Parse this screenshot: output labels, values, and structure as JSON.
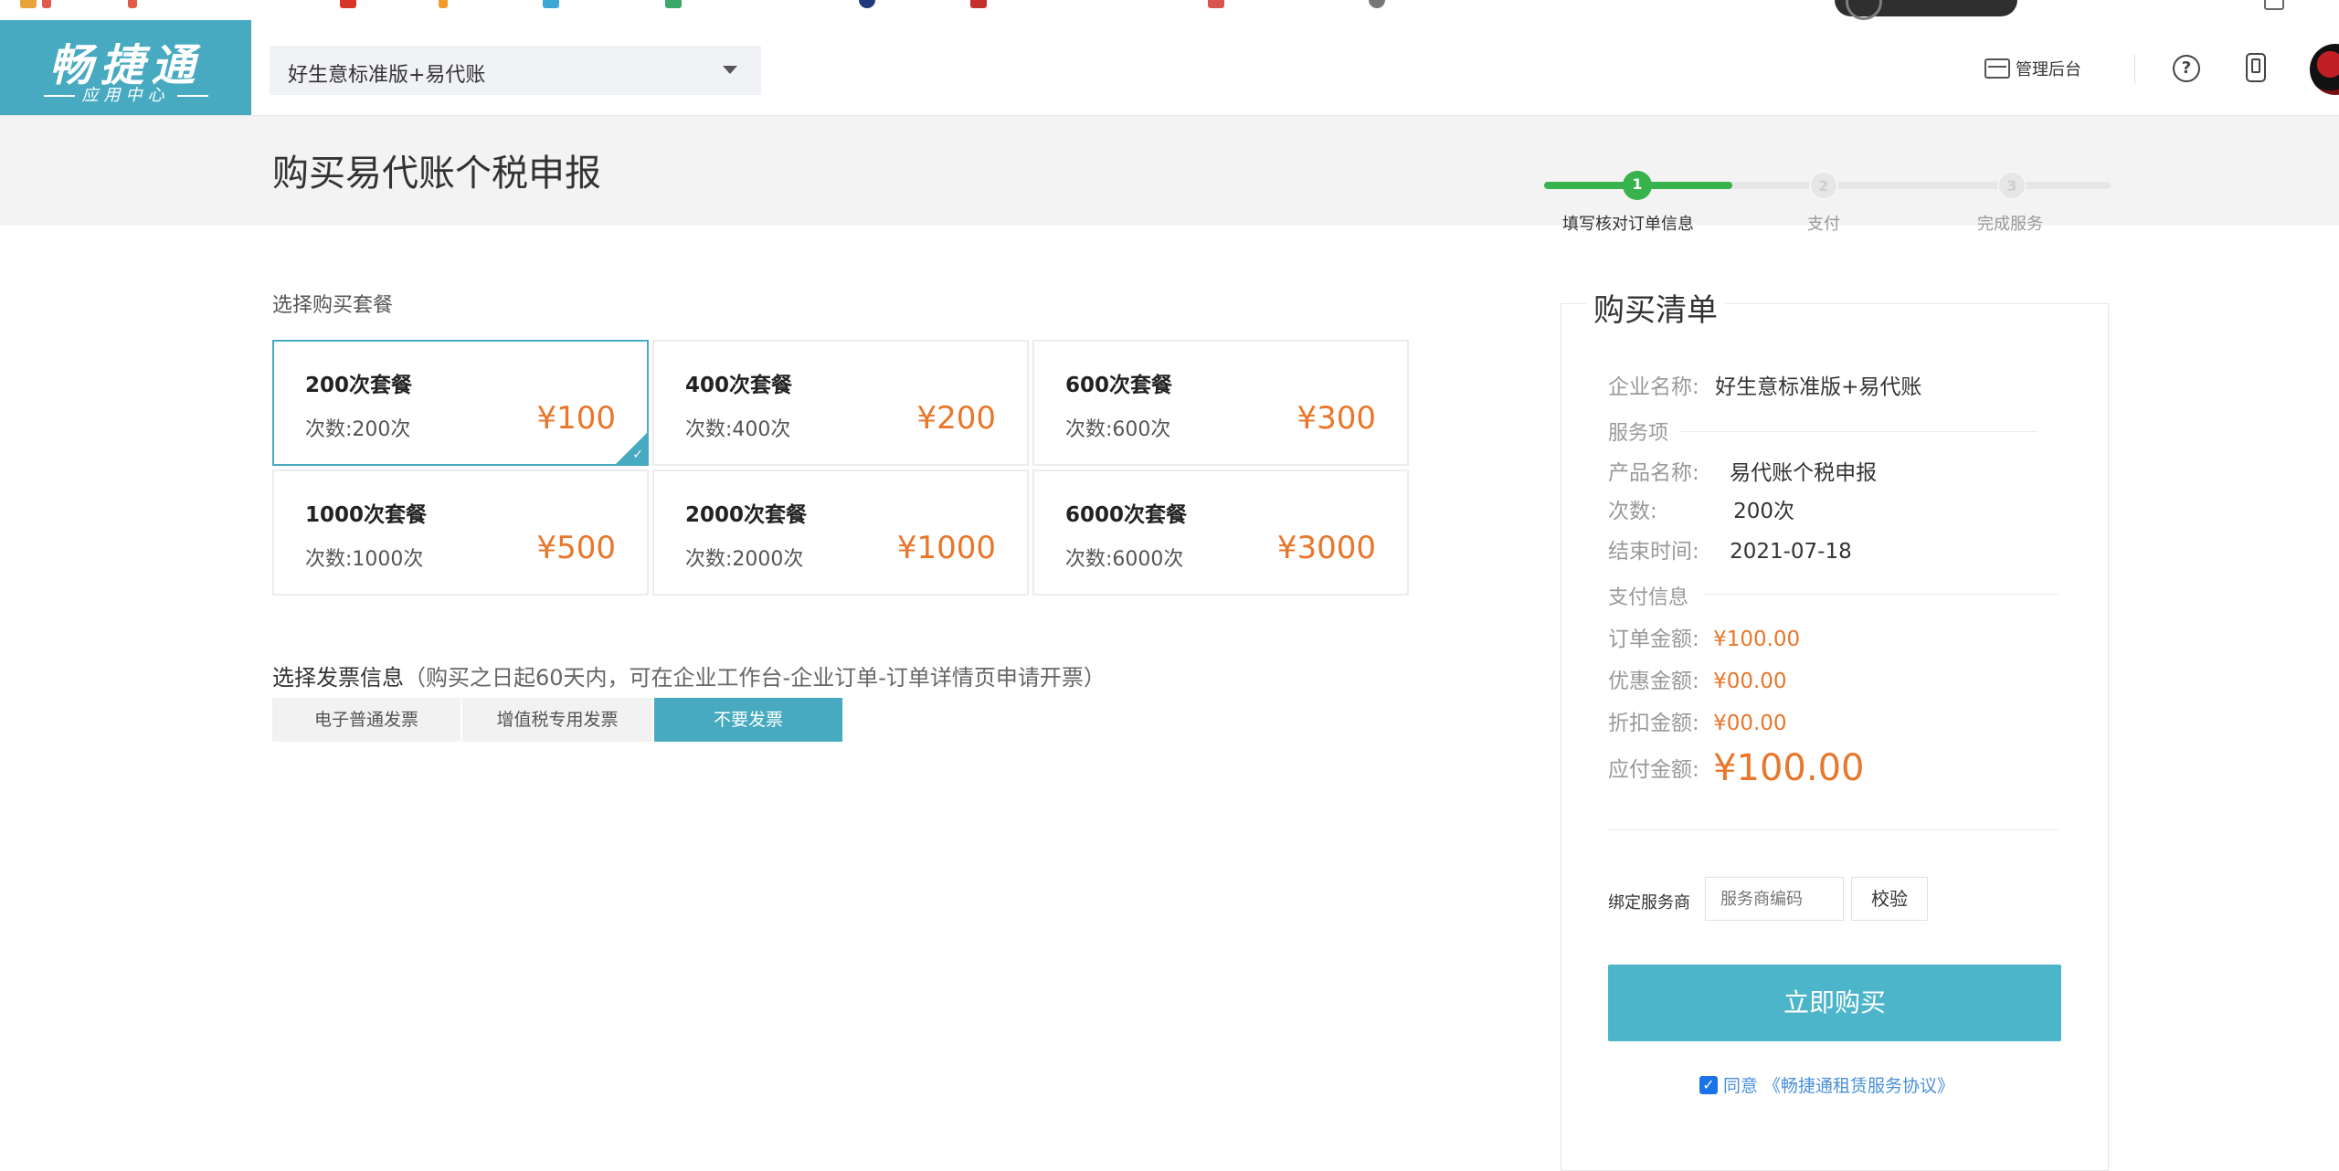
{
  "company": {
    "selected": "好生意标准版+易代账"
  },
  "header": {
    "admin_label": "管理后台"
  },
  "page": {
    "title": "购买易代账个税申报"
  },
  "steps": [
    {
      "num": "1",
      "label": "填写核对订单信息",
      "state": "active"
    },
    {
      "num": "2",
      "label": "支付",
      "state": "inactive"
    },
    {
      "num": "3",
      "label": "完成服务",
      "state": "inactive"
    }
  ],
  "packages": {
    "section_label": "选择购买套餐",
    "items": [
      {
        "name": "200次套餐",
        "count": "次数:200次",
        "price": "¥100",
        "selected": true
      },
      {
        "name": "400次套餐",
        "count": "次数:400次",
        "price": "¥200",
        "selected": false
      },
      {
        "name": "600次套餐",
        "count": "次数:600次",
        "price": "¥300",
        "selected": false
      },
      {
        "name": "1000次套餐",
        "count": "次数:1000次",
        "price": "¥500",
        "selected": false
      },
      {
        "name": "2000次套餐",
        "count": "次数:2000次",
        "price": "¥1000",
        "selected": false
      },
      {
        "name": "6000次套餐",
        "count": "次数:6000次",
        "price": "¥3000",
        "selected": false
      }
    ]
  },
  "invoice": {
    "title": "选择发票信息",
    "hint": "（购买之日起60天内，可在企业工作台-企业订单-订单详情页申请开票）",
    "options": [
      "电子普通发票",
      "增值税专用发票",
      "不要发票"
    ],
    "selected": "不要发票"
  },
  "cart": {
    "title": "购买清单",
    "company_label": "企业名称:",
    "company_value": "好生意标准版+易代账",
    "service_heading": "服务项",
    "product_label": "产品名称:",
    "product_value": "易代账个税申报",
    "count_label": "次数:",
    "count_value": "200次",
    "end_label": "结束时间:",
    "end_value": "2021-07-18",
    "pay_heading": "支付信息",
    "order_label": "订单金额:",
    "order_value": "¥100.00",
    "discount_label": "优惠金额:",
    "discount_value": "¥00.00",
    "rebate_label": "折扣金额:",
    "rebate_value": "¥00.00",
    "due_label": "应付金额:",
    "due_value": "¥100.00",
    "bind_label": "绑定服务商",
    "bind_placeholder": "服务商编码",
    "verify_label": "校验",
    "buy_label": "立即购买",
    "agree_prefix": "同意",
    "agree_link": "《畅捷通租赁服务协议》"
  },
  "colors": {
    "brand": "#47aac0",
    "price": "#e8762b",
    "step_active": "#37b24d",
    "buy_button": "#4db5ca"
  }
}
